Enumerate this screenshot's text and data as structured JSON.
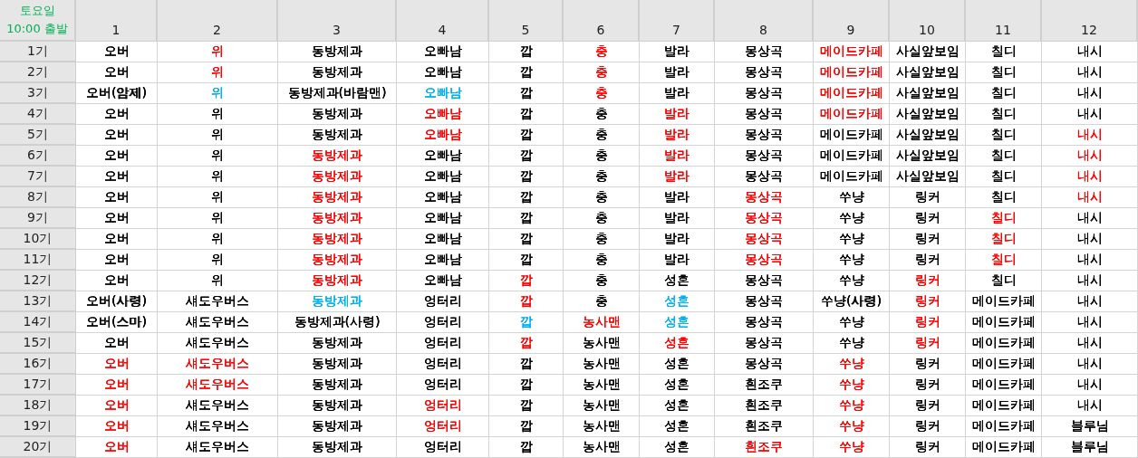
{
  "corner": {
    "day": "토요일",
    "departure": "10:00 출발"
  },
  "columns": [
    "1",
    "2",
    "3",
    "4",
    "5",
    "6",
    "7",
    "8",
    "9",
    "10",
    "11",
    "12"
  ],
  "rows": [
    {
      "label": "1기",
      "cells": [
        {
          "text": "오버"
        },
        {
          "text": "위",
          "color": "#ff0000"
        },
        {
          "text": "동방제과"
        },
        {
          "text": "오빠남"
        },
        {
          "text": "깝"
        },
        {
          "text": "충",
          "color": "#ff0000"
        },
        {
          "text": "발라"
        },
        {
          "text": "몽상곡"
        },
        {
          "text": "메이드카페",
          "color": "#ff0000"
        },
        {
          "text": "사실앞보임"
        },
        {
          "text": "칠디"
        },
        {
          "text": "내시"
        }
      ]
    },
    {
      "label": "2기",
      "cells": [
        {
          "text": "오버"
        },
        {
          "text": "위",
          "color": "#ff0000"
        },
        {
          "text": "동방제과"
        },
        {
          "text": "오빠남"
        },
        {
          "text": "깝"
        },
        {
          "text": "충",
          "color": "#ff0000"
        },
        {
          "text": "발라"
        },
        {
          "text": "몽상곡"
        },
        {
          "text": "메이드카페",
          "color": "#ff0000"
        },
        {
          "text": "사실앞보임"
        },
        {
          "text": "칠디"
        },
        {
          "text": "내시"
        }
      ]
    },
    {
      "label": "3기",
      "cells": [
        {
          "text": "오버(암제)"
        },
        {
          "text": "위",
          "color": "#00b0f0"
        },
        {
          "text": "동방제과(바람맨)"
        },
        {
          "text": "오빠남",
          "color": "#00b0f0"
        },
        {
          "text": "깝"
        },
        {
          "text": "충",
          "color": "#ff0000"
        },
        {
          "text": "발라"
        },
        {
          "text": "몽상곡"
        },
        {
          "text": "메이드카페",
          "color": "#ff0000"
        },
        {
          "text": "사실앞보임"
        },
        {
          "text": "칠디"
        },
        {
          "text": "내시"
        }
      ]
    },
    {
      "label": "4기",
      "cells": [
        {
          "text": "오버"
        },
        {
          "text": "위"
        },
        {
          "text": "동방제과"
        },
        {
          "text": "오빠남",
          "color": "#ff0000"
        },
        {
          "text": "깝"
        },
        {
          "text": "충"
        },
        {
          "text": "발라",
          "color": "#ff0000"
        },
        {
          "text": "몽상곡"
        },
        {
          "text": "메이드카페",
          "color": "#ff0000"
        },
        {
          "text": "사실앞보임"
        },
        {
          "text": "칠디"
        },
        {
          "text": "내시"
        }
      ]
    },
    {
      "label": "5기",
      "cells": [
        {
          "text": "오버"
        },
        {
          "text": "위"
        },
        {
          "text": "동방제과"
        },
        {
          "text": "오빠남",
          "color": "#ff0000"
        },
        {
          "text": "깝"
        },
        {
          "text": "충"
        },
        {
          "text": "발라",
          "color": "#ff0000"
        },
        {
          "text": "몽상곡"
        },
        {
          "text": "메이드카페"
        },
        {
          "text": "사실앞보임"
        },
        {
          "text": "칠디"
        },
        {
          "text": "내시",
          "color": "#ff0000"
        }
      ]
    },
    {
      "label": "6기",
      "cells": [
        {
          "text": "오버"
        },
        {
          "text": "위"
        },
        {
          "text": "동방제과",
          "color": "#ff0000"
        },
        {
          "text": "오빠남"
        },
        {
          "text": "깝"
        },
        {
          "text": "충"
        },
        {
          "text": "발라",
          "color": "#ff0000"
        },
        {
          "text": "몽상곡"
        },
        {
          "text": "메이드카페"
        },
        {
          "text": "사실앞보임"
        },
        {
          "text": "칠디"
        },
        {
          "text": "내시",
          "color": "#ff0000"
        }
      ]
    },
    {
      "label": "7기",
      "cells": [
        {
          "text": "오버"
        },
        {
          "text": "위"
        },
        {
          "text": "동방제과",
          "color": "#ff0000"
        },
        {
          "text": "오빠남"
        },
        {
          "text": "깝"
        },
        {
          "text": "충"
        },
        {
          "text": "발라",
          "color": "#ff0000"
        },
        {
          "text": "몽상곡"
        },
        {
          "text": "메이드카페"
        },
        {
          "text": "사실앞보임"
        },
        {
          "text": "칠디"
        },
        {
          "text": "내시",
          "color": "#ff0000"
        }
      ]
    },
    {
      "label": "8기",
      "cells": [
        {
          "text": "오버"
        },
        {
          "text": "위"
        },
        {
          "text": "동방제과",
          "color": "#ff0000"
        },
        {
          "text": "오빠남"
        },
        {
          "text": "깝"
        },
        {
          "text": "충"
        },
        {
          "text": "발라"
        },
        {
          "text": "몽상곡",
          "color": "#ff0000"
        },
        {
          "text": "쑤냥"
        },
        {
          "text": "링커"
        },
        {
          "text": "칠디"
        },
        {
          "text": "내시",
          "color": "#ff0000"
        }
      ]
    },
    {
      "label": "9기",
      "cells": [
        {
          "text": "오버"
        },
        {
          "text": "위"
        },
        {
          "text": "동방제과",
          "color": "#ff0000"
        },
        {
          "text": "오빠남"
        },
        {
          "text": "깝"
        },
        {
          "text": "충"
        },
        {
          "text": "발라"
        },
        {
          "text": "몽상곡",
          "color": "#ff0000"
        },
        {
          "text": "쑤냥"
        },
        {
          "text": "링커"
        },
        {
          "text": "칠디",
          "color": "#ff0000"
        },
        {
          "text": "내시"
        }
      ]
    },
    {
      "label": "10기",
      "cells": [
        {
          "text": "오버"
        },
        {
          "text": "위"
        },
        {
          "text": "동방제과",
          "color": "#ff0000"
        },
        {
          "text": "오빠남"
        },
        {
          "text": "깝"
        },
        {
          "text": "충"
        },
        {
          "text": "발라"
        },
        {
          "text": "몽상곡",
          "color": "#ff0000"
        },
        {
          "text": "쑤냥"
        },
        {
          "text": "링커"
        },
        {
          "text": "칠디",
          "color": "#ff0000"
        },
        {
          "text": "내시"
        }
      ]
    },
    {
      "label": "11기",
      "cells": [
        {
          "text": "오버"
        },
        {
          "text": "위"
        },
        {
          "text": "동방제과",
          "color": "#ff0000"
        },
        {
          "text": "오빠남"
        },
        {
          "text": "깝"
        },
        {
          "text": "충"
        },
        {
          "text": "발라"
        },
        {
          "text": "몽상곡",
          "color": "#ff0000"
        },
        {
          "text": "쑤냥"
        },
        {
          "text": "링커"
        },
        {
          "text": "칠디",
          "color": "#ff0000"
        },
        {
          "text": "내시"
        }
      ]
    },
    {
      "label": "12기",
      "cells": [
        {
          "text": "오버"
        },
        {
          "text": "위"
        },
        {
          "text": "동방제과",
          "color": "#ff0000"
        },
        {
          "text": "오빠남"
        },
        {
          "text": "깝",
          "color": "#ff0000"
        },
        {
          "text": "충"
        },
        {
          "text": "성흔"
        },
        {
          "text": "몽상곡"
        },
        {
          "text": "쑤냥"
        },
        {
          "text": "링커",
          "color": "#ff0000"
        },
        {
          "text": "칠디"
        },
        {
          "text": "내시"
        }
      ]
    },
    {
      "label": "13기",
      "cells": [
        {
          "text": "오버(사령)"
        },
        {
          "text": "섀도우버스"
        },
        {
          "text": "동방제과",
          "color": "#00b0f0"
        },
        {
          "text": "엉터리"
        },
        {
          "text": "깝",
          "color": "#ff0000"
        },
        {
          "text": "충"
        },
        {
          "text": "성흔",
          "color": "#00b0f0"
        },
        {
          "text": "몽상곡"
        },
        {
          "text": "쑤냥(사령)"
        },
        {
          "text": "링커",
          "color": "#ff0000"
        },
        {
          "text": "메이드카페"
        },
        {
          "text": "내시"
        }
      ]
    },
    {
      "label": "14기",
      "cells": [
        {
          "text": "오버(스마)"
        },
        {
          "text": "섀도우버스"
        },
        {
          "text": "동방제과(사령)"
        },
        {
          "text": "엉터리"
        },
        {
          "text": "깝",
          "color": "#00b0f0"
        },
        {
          "text": "농사맨",
          "color": "#ff0000"
        },
        {
          "text": "성흔",
          "color": "#00b0f0"
        },
        {
          "text": "몽상곡"
        },
        {
          "text": "쑤냥"
        },
        {
          "text": "링커",
          "color": "#ff0000"
        },
        {
          "text": "메이드카페"
        },
        {
          "text": "내시"
        }
      ]
    },
    {
      "label": "15기",
      "cells": [
        {
          "text": "오버"
        },
        {
          "text": "섀도우버스"
        },
        {
          "text": "동방제과"
        },
        {
          "text": "엉터리"
        },
        {
          "text": "깝",
          "color": "#ff0000"
        },
        {
          "text": "농사맨"
        },
        {
          "text": "성흔",
          "color": "#ff0000"
        },
        {
          "text": "몽상곡"
        },
        {
          "text": "쑤냥"
        },
        {
          "text": "링커",
          "color": "#ff0000"
        },
        {
          "text": "메이드카페"
        },
        {
          "text": "내시"
        }
      ]
    },
    {
      "label": "16기",
      "cells": [
        {
          "text": "오버",
          "color": "#ff0000"
        },
        {
          "text": "섀도우버스",
          "color": "#ff0000"
        },
        {
          "text": "동방제과"
        },
        {
          "text": "엉터리"
        },
        {
          "text": "깝"
        },
        {
          "text": "농사맨"
        },
        {
          "text": "성흔"
        },
        {
          "text": "몽상곡"
        },
        {
          "text": "쑤냥",
          "color": "#ff0000"
        },
        {
          "text": "링커"
        },
        {
          "text": "메이드카페"
        },
        {
          "text": "내시"
        }
      ]
    },
    {
      "label": "17기",
      "cells": [
        {
          "text": "오버",
          "color": "#ff0000"
        },
        {
          "text": "섀도우버스",
          "color": "#ff0000"
        },
        {
          "text": "동방제과"
        },
        {
          "text": "엉터리"
        },
        {
          "text": "깝"
        },
        {
          "text": "농사맨"
        },
        {
          "text": "성흔"
        },
        {
          "text": "흰조쿠"
        },
        {
          "text": "쑤냥",
          "color": "#ff0000"
        },
        {
          "text": "링커"
        },
        {
          "text": "메이드카페"
        },
        {
          "text": "내시"
        }
      ]
    },
    {
      "label": "18기",
      "cells": [
        {
          "text": "오버",
          "color": "#ff0000"
        },
        {
          "text": "섀도우버스"
        },
        {
          "text": "동방제과"
        },
        {
          "text": "엉터리",
          "color": "#ff0000"
        },
        {
          "text": "깝"
        },
        {
          "text": "농사맨"
        },
        {
          "text": "성흔"
        },
        {
          "text": "흰조쿠"
        },
        {
          "text": "쑤냥",
          "color": "#ff0000"
        },
        {
          "text": "링커"
        },
        {
          "text": "메이드카페"
        },
        {
          "text": "내시"
        }
      ]
    },
    {
      "label": "19기",
      "cells": [
        {
          "text": "오버",
          "color": "#ff0000"
        },
        {
          "text": "섀도우버스"
        },
        {
          "text": "동방제과"
        },
        {
          "text": "엉터리",
          "color": "#ff0000"
        },
        {
          "text": "깝"
        },
        {
          "text": "농사맨"
        },
        {
          "text": "성흔"
        },
        {
          "text": "흰조쿠"
        },
        {
          "text": "쑤냥",
          "color": "#ff0000"
        },
        {
          "text": "링커"
        },
        {
          "text": "메이드카페"
        },
        {
          "text": "블루님"
        }
      ]
    },
    {
      "label": "20기",
      "cells": [
        {
          "text": "오버",
          "color": "#ff0000"
        },
        {
          "text": "섀도우버스"
        },
        {
          "text": "동방제과"
        },
        {
          "text": "엉터리"
        },
        {
          "text": "깝"
        },
        {
          "text": "농사맨"
        },
        {
          "text": "성흔"
        },
        {
          "text": "흰조쿠",
          "color": "#ff0000"
        },
        {
          "text": "쑤냥",
          "color": "#ff0000"
        },
        {
          "text": "링커"
        },
        {
          "text": "메이드카페"
        },
        {
          "text": "블루님"
        }
      ]
    }
  ]
}
